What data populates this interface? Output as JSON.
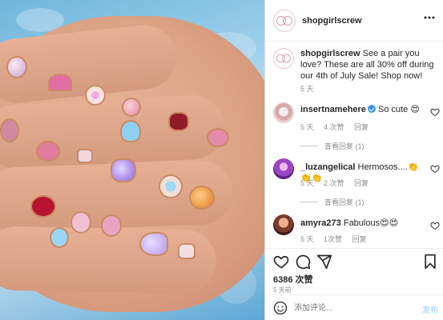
{
  "post": {
    "username": "shopgirlscrew",
    "caption": "See a pair you love? These are all 30% off during our 4th of July Sale! Shop now!",
    "caption_time": "5 天"
  },
  "comments": [
    {
      "username": "insertnamehere",
      "verified": true,
      "text": "So cute 😍",
      "time": "5 天",
      "likes": "4 次赞",
      "reply": "回复",
      "view_replies": "查看回复 (1)"
    },
    {
      "username": "_luzangelical",
      "verified": false,
      "text": "Hermosos....👏👏👏",
      "time": "5 天",
      "likes": "2 次赞",
      "reply": "回复",
      "view_replies": "查看回复 (1)"
    },
    {
      "username": "amyra273",
      "verified": false,
      "text": "Fabulous😍😍",
      "time": "5 天",
      "likes": "1次赞",
      "reply": "回复"
    }
  ],
  "stats": {
    "likes": "6386 次赞",
    "posted": "5 天前"
  },
  "add_comment": {
    "placeholder": "添加评论...",
    "post_label": "发布"
  },
  "icons": [
    "more-icon",
    "heart-icon",
    "comment-icon",
    "share-icon",
    "bookmark-icon",
    "emoji-icon",
    "verified-icon"
  ],
  "colors": {
    "link_blue": "#b2dffc",
    "verified": "#3897f0",
    "secondary_text": "#8e8e8e"
  }
}
